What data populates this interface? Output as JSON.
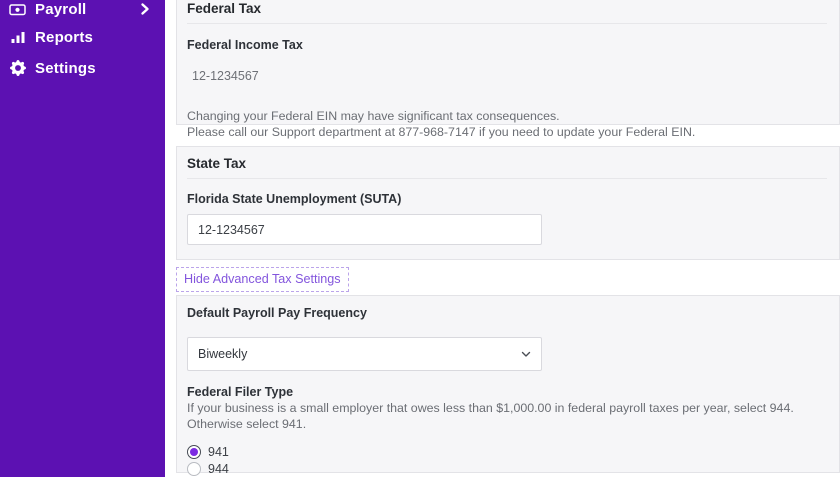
{
  "sidebar": {
    "items": [
      {
        "label": "Payroll",
        "icon": "banknote-icon",
        "has_chevron": true
      },
      {
        "label": "Reports",
        "icon": "bar-chart-icon",
        "has_chevron": false
      },
      {
        "label": "Settings",
        "icon": "gear-icon",
        "has_chevron": false
      }
    ]
  },
  "federal_tax": {
    "title": "Federal Tax",
    "ein_label": "Federal Income Tax",
    "ein_value": "12-1234567",
    "note_line1": "Changing your Federal EIN may have significant tax consequences.",
    "note_line2": "Please call our Support department at 877-968-7147 if you need to update your Federal EIN."
  },
  "state_tax": {
    "title": "State Tax",
    "suta_label": "Florida State Unemployment (SUTA)",
    "suta_value": "12-1234567"
  },
  "advanced_link": {
    "label": "Hide Advanced Tax Settings"
  },
  "advanced_settings": {
    "pay_frequency_label": "Default Payroll Pay Frequency",
    "pay_frequency_value": "Biweekly",
    "filer_type_label": "Federal Filer Type",
    "filer_type_help": "If your business is a small employer that owes less than $1,000.00 in federal payroll taxes per year, select 944. Otherwise select 941.",
    "filer_options": [
      {
        "label": "941",
        "selected": true
      },
      {
        "label": "944",
        "selected": false
      }
    ]
  },
  "colors": {
    "sidebar_purple": "#5c11b2",
    "link_purple": "#8355dd",
    "radio_purple": "#7c2be2",
    "card_background": "#f6f6f8",
    "card_border": "#e3e3e7"
  }
}
